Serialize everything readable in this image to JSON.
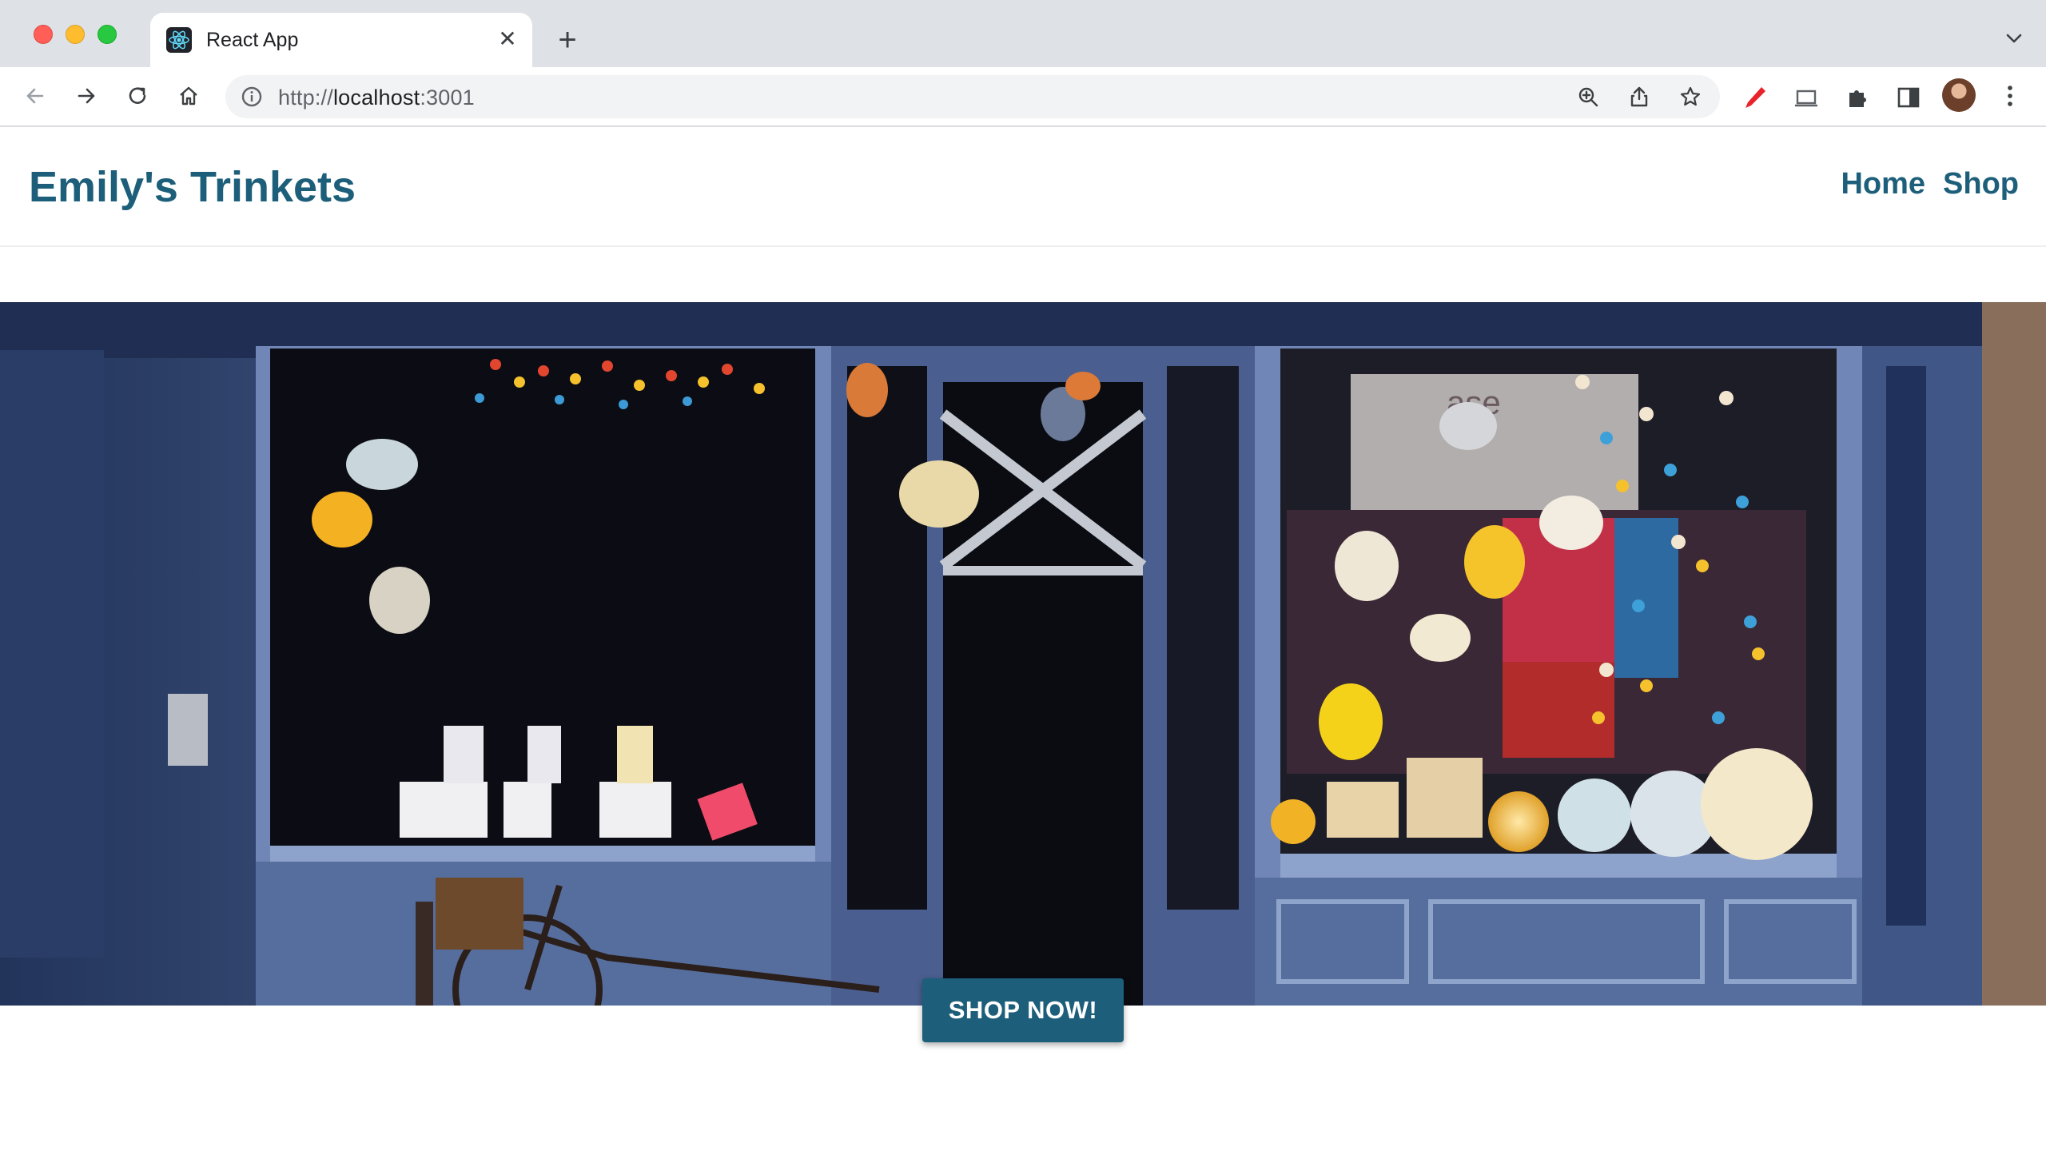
{
  "browser": {
    "tab_title": "React App",
    "url_scheme": "http://",
    "url_host": "localhost",
    "url_port": ":3001"
  },
  "site": {
    "brand": "Emily's Trinkets",
    "nav": [
      {
        "label": "Home"
      },
      {
        "label": "Shop"
      }
    ],
    "cta_label": "SHOP NOW!"
  },
  "hero": {
    "image": "storefront-photo"
  },
  "colors": {
    "brand": "#1d5f7a",
    "chrome_bg": "#dee1e6"
  }
}
